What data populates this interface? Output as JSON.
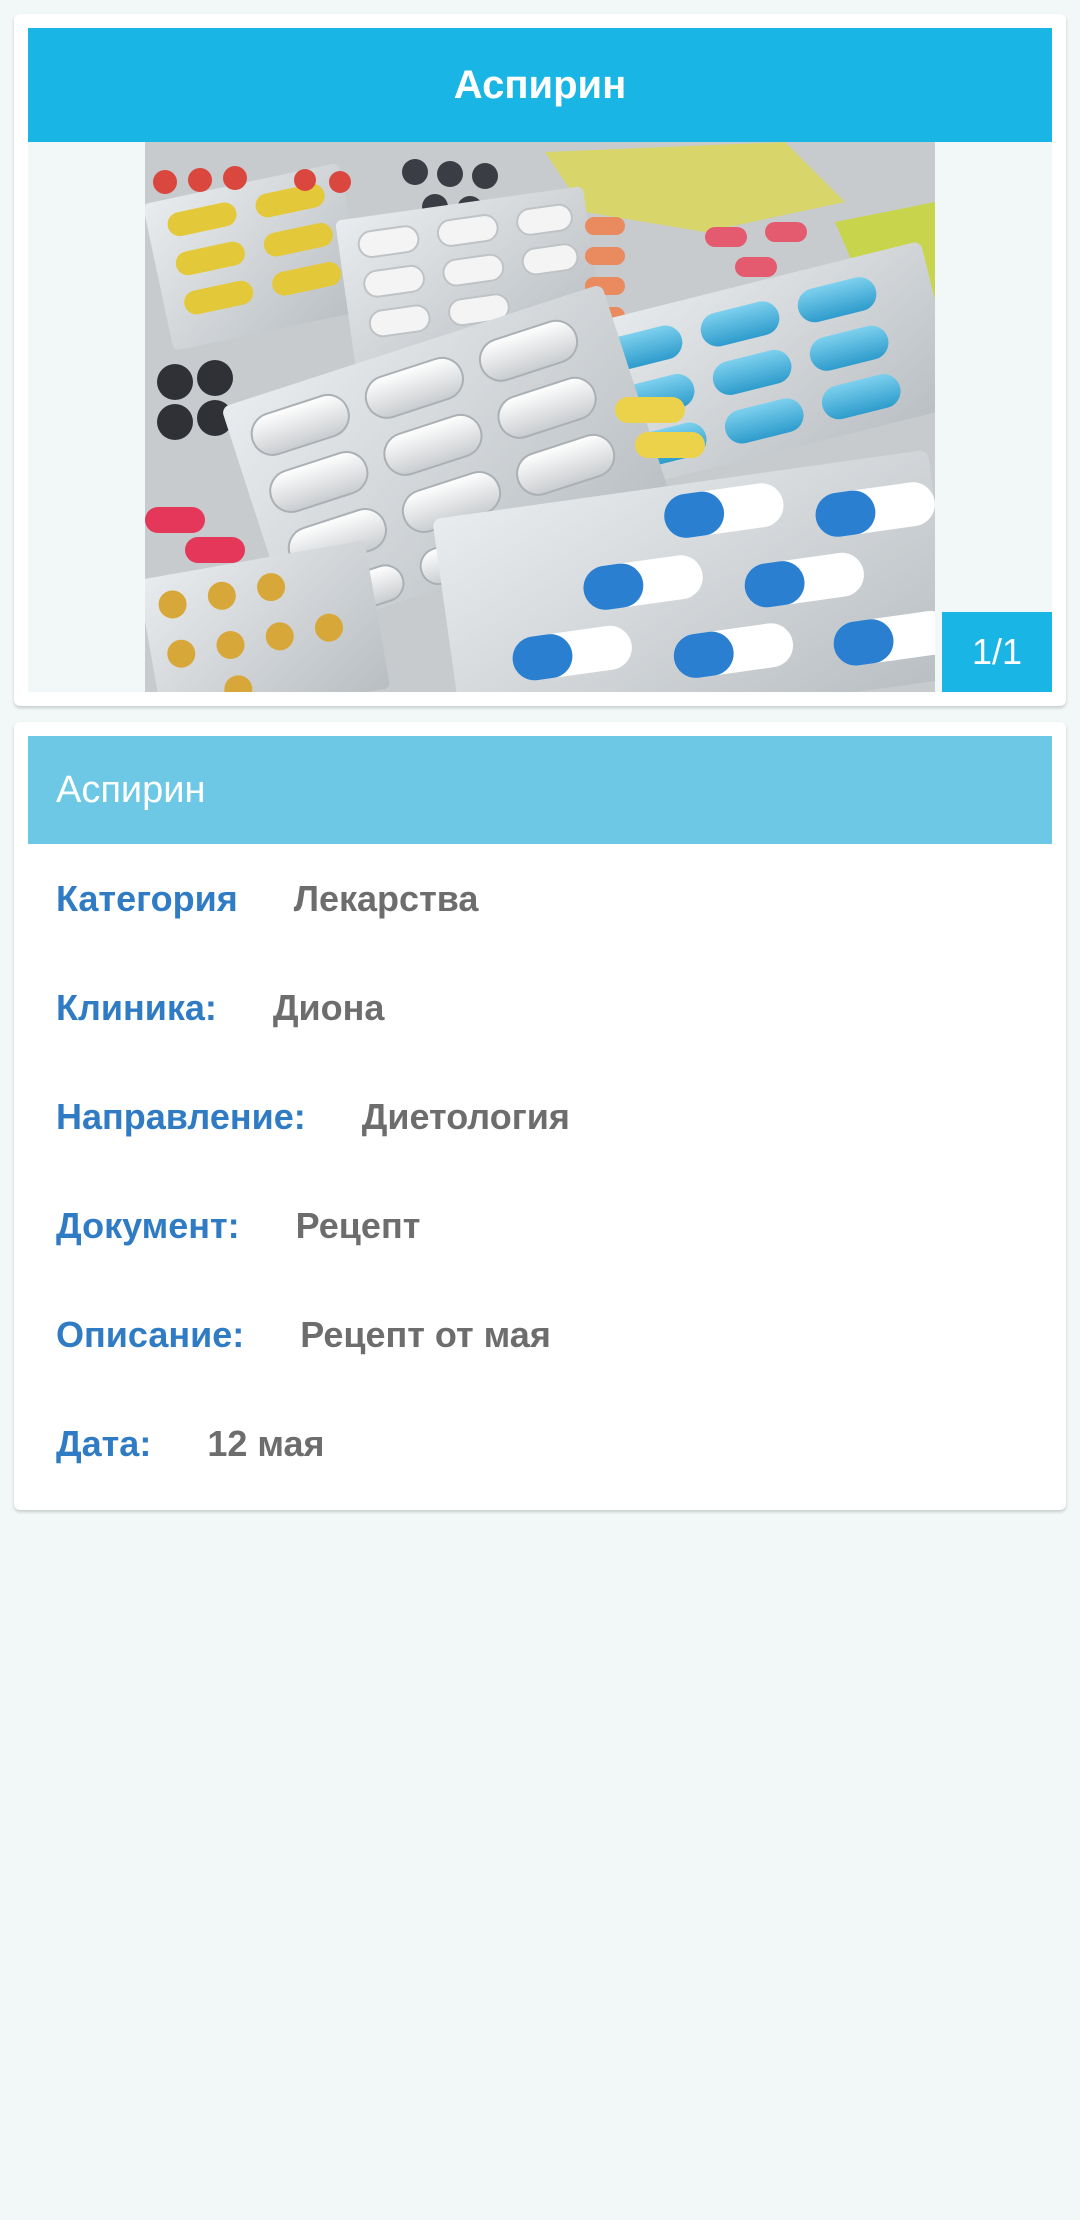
{
  "gallery": {
    "title": "Аспирин",
    "counter": "1/1",
    "image_subject": "pill blister packs"
  },
  "details": {
    "header": "Аспирин",
    "rows": [
      {
        "label": "Категория",
        "value": "Лекарства"
      },
      {
        "label": "Клиника:",
        "value": "Диона"
      },
      {
        "label": "Направление:",
        "value": "Диетология"
      },
      {
        "label": "Документ:",
        "value": "Рецепт"
      },
      {
        "label": "Описание:",
        "value": "Рецепт от мая"
      },
      {
        "label": "Дата:",
        "value": "12 мая"
      }
    ]
  },
  "colors": {
    "primary": "#19b5e5",
    "header_light": "#6cc8e4",
    "label": "#2f7bc4",
    "value": "#6d6d6d",
    "background": "#f2f7f7"
  }
}
